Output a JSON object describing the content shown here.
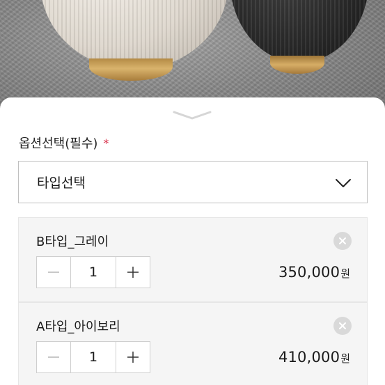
{
  "option_section": {
    "label": "옵션선택(필수)",
    "required_mark": "*",
    "select": {
      "value": "타입선택"
    }
  },
  "selected_items": [
    {
      "name": "B타입_그레이",
      "quantity": "1",
      "price": "350,000",
      "currency": "원"
    },
    {
      "name": "A타입_아이보리",
      "quantity": "1",
      "price": "410,000",
      "currency": "원"
    }
  ],
  "icons": {
    "sheet_handle": "chevron-down-icon",
    "select_toggle": "chevron-down-icon",
    "remove": "close-icon",
    "decrease": "minus-icon",
    "increase": "plus-icon"
  },
  "colors": {
    "required": "#d9304a",
    "card_background": "#f5f5f5",
    "border": "#bfbfbf"
  }
}
